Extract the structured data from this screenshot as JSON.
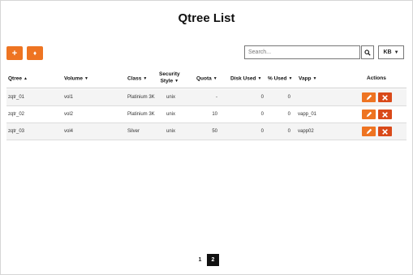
{
  "page": {
    "title": "Qtree List"
  },
  "toolbar": {
    "add_label": "+",
    "sort_label": "♦",
    "search_placeholder": "Search...",
    "unit_value": "KB"
  },
  "table": {
    "headers": {
      "qtree": "Qtree",
      "volume": "Volume",
      "class": "Class",
      "security_line1": "Security",
      "security_line2": "Style",
      "quota": "Quota",
      "disk_used": "Disk Used",
      "pct_used": "% Used",
      "vapp": "Vapp",
      "actions": "Actions"
    },
    "rows": [
      {
        "qtree": "zqtr_01",
        "volume": "vol1",
        "class": "Platinium 3K",
        "security": "unix",
        "quota": "-",
        "disk_used": "0",
        "pct_used": "0",
        "vapp": ""
      },
      {
        "qtree": "zqtr_02",
        "volume": "vol2",
        "class": "Platinium 3K",
        "security": "unix",
        "quota": "10",
        "disk_used": "0",
        "pct_used": "0",
        "vapp": "vapp_01"
      },
      {
        "qtree": "zqtr_03",
        "volume": "vol4",
        "class": "Silver",
        "security": "unix",
        "quota": "50",
        "disk_used": "0",
        "pct_used": "0",
        "vapp": "vapp02"
      }
    ]
  },
  "pagination": {
    "pages": [
      "1",
      "2"
    ],
    "current": "2"
  },
  "colors": {
    "accent": "#ee7422",
    "delete": "#d94a1a"
  }
}
